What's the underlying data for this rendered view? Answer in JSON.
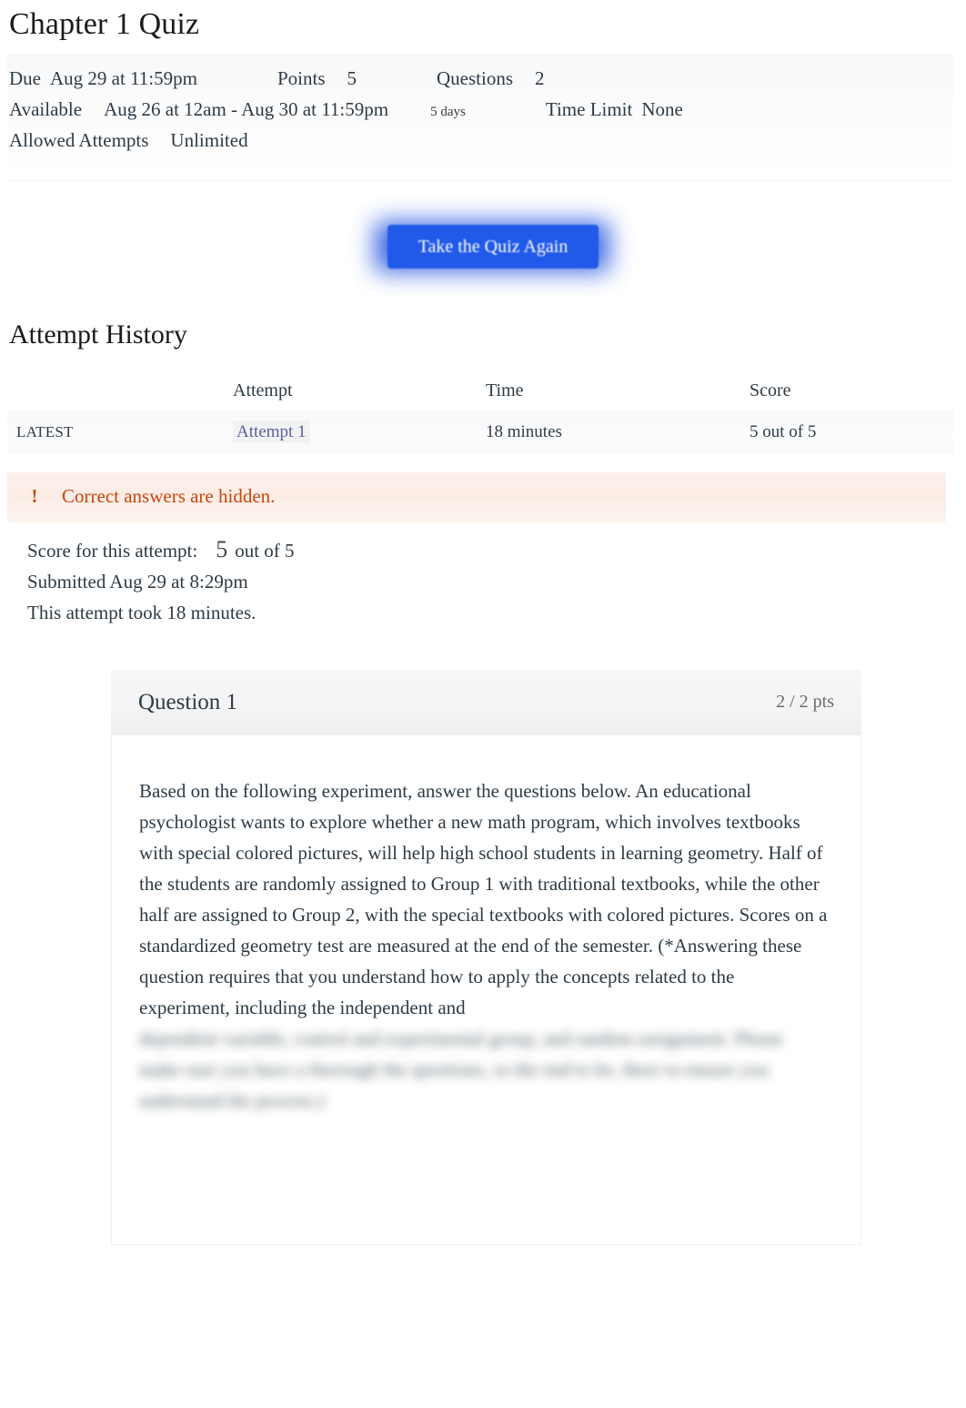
{
  "page": {
    "title": "Chapter 1 Quiz"
  },
  "quiz_meta": {
    "due_label": "Due",
    "due_value": "Aug 29 at 11:59pm",
    "points_label": "Points",
    "points_value": "5",
    "questions_label": "Questions",
    "questions_value": "2",
    "available_label": "Available",
    "available_value": "Aug 26 at 12am - Aug 30 at 11:59pm",
    "available_duration": "5 days",
    "time_limit_label": "Time Limit",
    "time_limit_value": "None",
    "allowed_attempts_label": "Allowed Attempts",
    "allowed_attempts_value": "Unlimited"
  },
  "actions": {
    "take_quiz_again": "Take the Quiz Again"
  },
  "attempt_history": {
    "heading": "Attempt History",
    "columns": {
      "kept": "",
      "attempt": "Attempt",
      "time": "Time",
      "score": "Score"
    },
    "rows": [
      {
        "kept": "LATEST",
        "attempt": "Attempt 1",
        "time": "18 minutes",
        "score": "5 out of 5"
      }
    ]
  },
  "warning": {
    "icon": "!",
    "text": "Correct answers are hidden.",
    "text_color": "#c5470e",
    "background_color": "#fbece5"
  },
  "attempt_summary": {
    "score_label": "Score for this attempt:",
    "score_value": "5",
    "score_suffix": "out of 5",
    "submitted": "Submitted Aug 29 at 8:29pm",
    "duration": "This attempt took 18 minutes."
  },
  "question": {
    "title": "Question 1",
    "points": "2 / 2 pts",
    "text": "Based on the following experiment, answer the questions below. An educational psychologist wants to explore whether a new math program, which involves textbooks with special colored pictures, will help high school students in learning geometry. Half of the students are randomly assigned to Group 1 with traditional textbooks, while the other half are assigned to Group 2, with the special textbooks with colored pictures. Scores on a standardized geometry test are measured at the end of the semester. (*Answering these question requires that you understand how to apply the concepts related to the experiment, including the independent and",
    "text_obscured": "dependent variable, control and experimental group, and random assignment. Please make sure you have a thorough the questions, so the end to be, there to ensure you understand the process.)"
  },
  "colors": {
    "accent_blue": "#2159e8",
    "link_blue": "#5a5f9e",
    "warning_orange": "#c5470e",
    "text_dark": "#2d3b45"
  }
}
